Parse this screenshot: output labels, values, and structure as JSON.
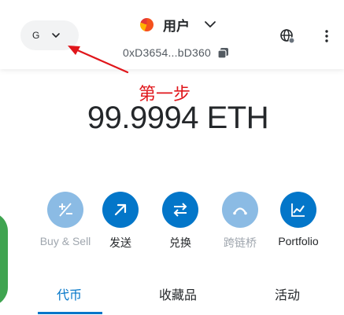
{
  "header": {
    "network_letter": "G",
    "account_name": "用户",
    "address": "0xD3654...bD360",
    "icons": {
      "network_chevron": "chevron-down-icon",
      "account_chevron": "chevron-down-icon",
      "copy": "copy-icon",
      "globe": "globe-icon",
      "menu": "kebab-menu-icon"
    }
  },
  "annotation": {
    "step_label": "第一步",
    "color": "#e0161b"
  },
  "balance": {
    "amount": "99.9994",
    "currency": "ETH",
    "display": "99.9994 ETH"
  },
  "actions": [
    {
      "label": "Buy & Sell",
      "icon": "plus-minus-icon",
      "enabled": false
    },
    {
      "label": "发送",
      "icon": "send-arrow-icon",
      "enabled": true
    },
    {
      "label": "兑换",
      "icon": "swap-icon",
      "enabled": true
    },
    {
      "label": "跨链桥",
      "icon": "bridge-icon",
      "enabled": false
    },
    {
      "label": "Portfolio",
      "icon": "chart-icon",
      "enabled": true
    }
  ],
  "tabs": [
    {
      "label": "代币",
      "active": true
    },
    {
      "label": "收藏品",
      "active": false
    },
    {
      "label": "活动",
      "active": false
    }
  ],
  "colors": {
    "accent": "#0376c9",
    "disabled_accent": "#8bbbe4",
    "text": "#24272a",
    "pill_bg": "#f2f3f4"
  }
}
